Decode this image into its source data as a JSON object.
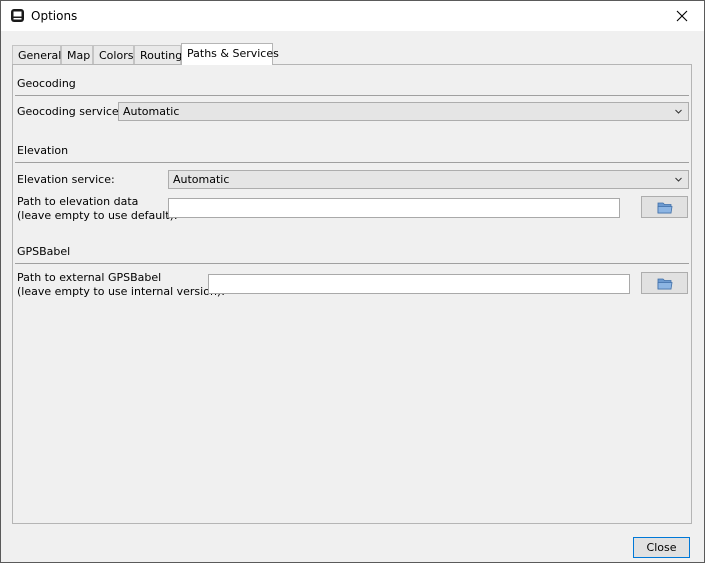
{
  "window": {
    "title": "Options",
    "icon": "gps-device-icon"
  },
  "tabs": [
    {
      "label": "General"
    },
    {
      "label": "Map"
    },
    {
      "label": "Colors"
    },
    {
      "label": "Routing"
    },
    {
      "label": "Paths & Services",
      "active": true
    }
  ],
  "geocoding": {
    "section": "Geocoding",
    "service_label": "Geocoding service:",
    "service_value": "Automatic"
  },
  "elevation": {
    "section": "Elevation",
    "service_label": "Elevation service:",
    "service_value": "Automatic",
    "path_label_1": "Path to elevation data",
    "path_label_2": "(leave empty to use default):",
    "path_value": ""
  },
  "gpsbabel": {
    "section": "GPSBabel",
    "path_label_1": "Path to external GPSBabel",
    "path_label_2": "(leave empty to use internal version):",
    "path_value": ""
  },
  "footer": {
    "close_label": "Close"
  },
  "colors": {
    "accent": "#0078d7",
    "folder": "#4f81bd"
  }
}
